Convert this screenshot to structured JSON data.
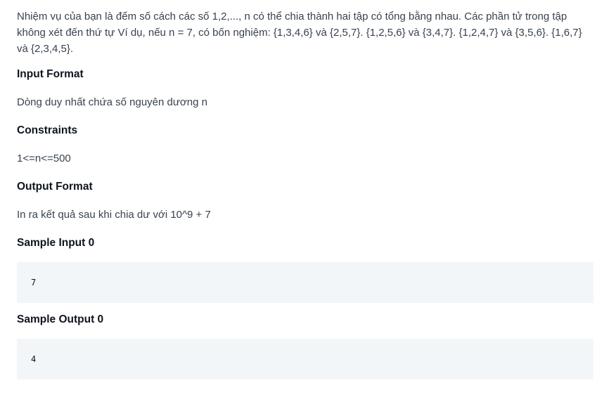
{
  "problem": {
    "statement": "Nhiệm vụ của bạn là đếm số cách các số 1,2,..., n có thể chia thành hai tập có tổng bằng nhau. Các phần tử trong tập không xét đến thứ tự Ví dụ, nếu n = 7, có bốn nghiệm: {1,3,4,6} và {2,5,7}. {1,2,5,6} và {3,4,7}. {1,2,4,7} và {3,5,6}. {1,6,7} và {2,3,4,5}."
  },
  "sections": {
    "input_format": {
      "title": "Input Format",
      "body": "Dòng duy nhất chứa số nguyên dương n"
    },
    "constraints": {
      "title": "Constraints",
      "body": "1<=n<=500"
    },
    "output_format": {
      "title": "Output Format",
      "body": "In ra kết quả sau khi chia dư với 10^9 + 7"
    },
    "sample_input": {
      "title": "Sample Input 0",
      "code": "7"
    },
    "sample_output": {
      "title": "Sample Output 0",
      "code": "4"
    }
  }
}
